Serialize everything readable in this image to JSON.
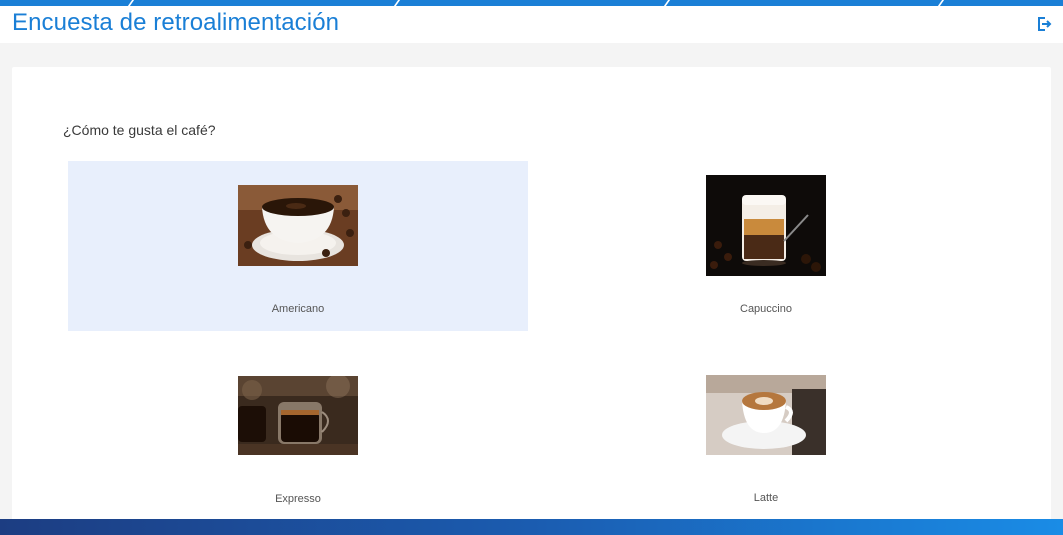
{
  "header": {
    "title": "Encuesta de retroalimentación",
    "logout_icon": "logout-icon",
    "accent_color": "#1a7fd6"
  },
  "survey": {
    "question": "¿Cómo te gusta el café?",
    "selected_option": "Americano",
    "selected_color": "#e8effc",
    "options": [
      {
        "label": "Americano",
        "image": "americano-image"
      },
      {
        "label": "Capuccino",
        "image": "capuccino-image"
      },
      {
        "label": "Expresso",
        "image": "expresso-image"
      },
      {
        "label": "Latte",
        "image": "latte-image"
      }
    ]
  }
}
